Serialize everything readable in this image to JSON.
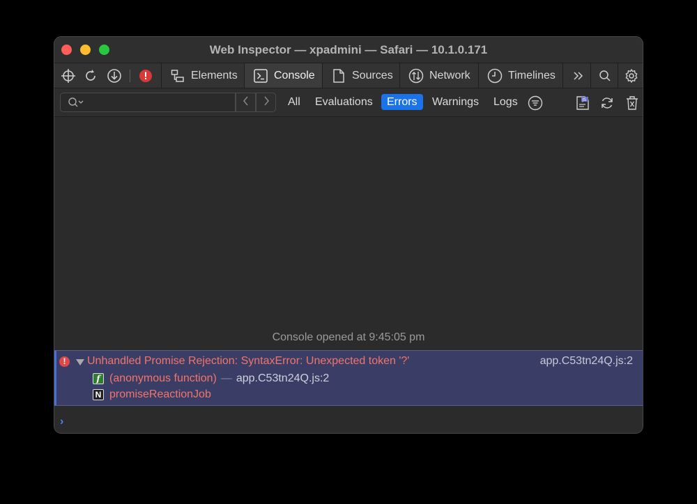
{
  "window": {
    "title": "Web Inspector — xpadmini — Safari — 10.1.0.171"
  },
  "toolbar": {
    "left_icons": [
      "crosshair-icon",
      "reload-icon",
      "download-icon",
      "error-badge-icon"
    ],
    "tabs": [
      {
        "label": "Elements",
        "icon": "elements-icon",
        "active": false
      },
      {
        "label": "Console",
        "icon": "console-icon",
        "active": true
      },
      {
        "label": "Sources",
        "icon": "document-icon",
        "active": false
      },
      {
        "label": "Network",
        "icon": "network-icon",
        "active": false
      },
      {
        "label": "Timelines",
        "icon": "clock-icon",
        "active": false
      }
    ],
    "overflow_icon": "chevron-double-right-icon",
    "right_icons": [
      "search-icon",
      "gear-icon"
    ]
  },
  "filters": {
    "search_placeholder": "",
    "items": [
      {
        "label": "All",
        "active": false
      },
      {
        "label": "Evaluations",
        "active": false
      },
      {
        "label": "Errors",
        "active": true
      },
      {
        "label": "Warnings",
        "active": false
      },
      {
        "label": "Logs",
        "active": false
      }
    ],
    "accent": "#1a73e8"
  },
  "console": {
    "opened_message": "Console opened at 9:45:05 pm",
    "error": {
      "message": "Unhandled Promise Rejection: SyntaxError: Unexpected token '?'",
      "source": "app.C53tn24Q.js:2",
      "frames": [
        {
          "badge": "f",
          "name": "(anonymous function)",
          "separator": "—",
          "location": "app.C53tn24Q.js:2"
        },
        {
          "badge": "N",
          "name": "promiseReactionJob",
          "separator": "",
          "location": ""
        }
      ]
    },
    "prompt": "›"
  },
  "colors": {
    "error_text": "#f2746a",
    "error_row_bg": "#3a3e66",
    "prompt": "#3d8bff"
  }
}
